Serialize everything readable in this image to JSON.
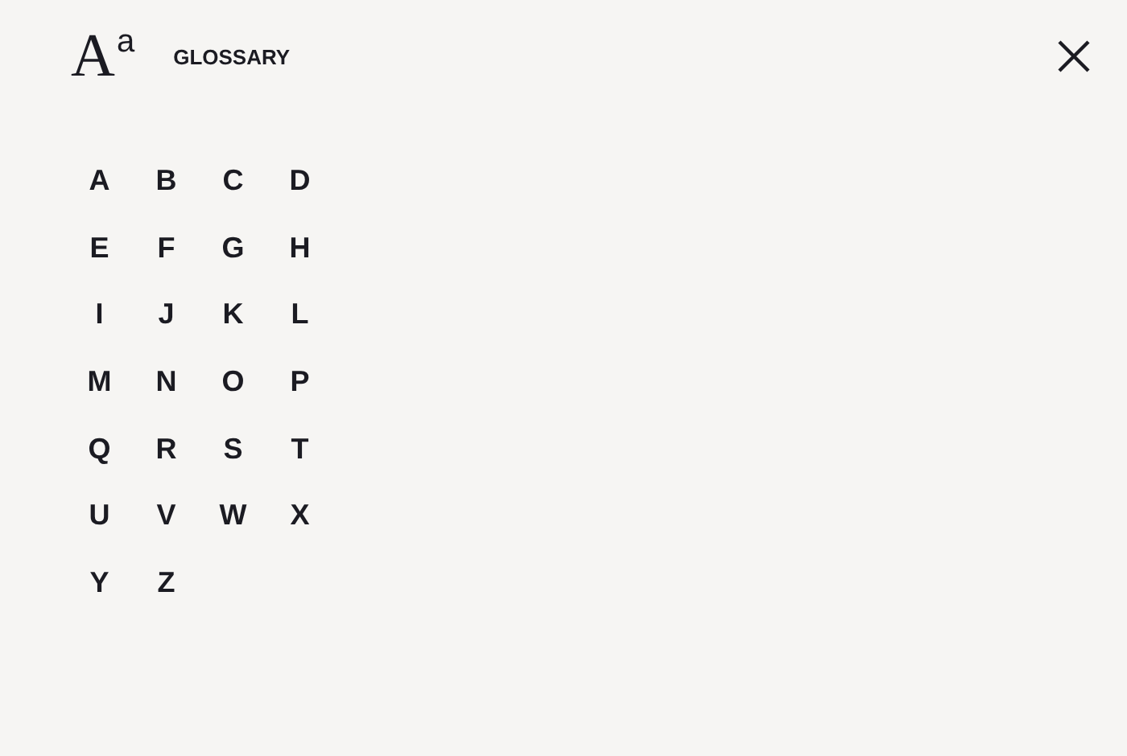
{
  "header": {
    "logo": {
      "large": "A",
      "small": "a"
    },
    "title": "GLOSSARY"
  },
  "letters": [
    "A",
    "B",
    "C",
    "D",
    "E",
    "F",
    "G",
    "H",
    "I",
    "J",
    "K",
    "L",
    "M",
    "N",
    "O",
    "P",
    "Q",
    "R",
    "S",
    "T",
    "U",
    "V",
    "W",
    "X",
    "Y",
    "Z"
  ]
}
